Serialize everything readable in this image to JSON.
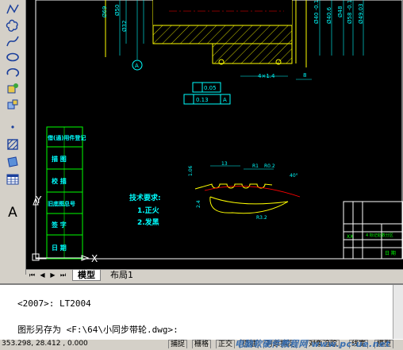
{
  "toolbar": {
    "tools": [
      {
        "icon": "polyline-icon"
      },
      {
        "icon": "revcloud-icon"
      },
      {
        "icon": "spline-icon"
      },
      {
        "icon": "ellipse-icon"
      },
      {
        "icon": "ellipse-arc-icon"
      },
      {
        "icon": "insert-block-icon"
      },
      {
        "icon": "make-block-icon"
      },
      {
        "icon": "point-icon"
      },
      {
        "icon": "hatch-icon"
      },
      {
        "icon": "region-icon"
      },
      {
        "icon": "table-icon"
      },
      {
        "icon": "mtext-icon",
        "glyph": "A"
      }
    ]
  },
  "drawing": {
    "dims": {
      "d1": "4×1.4",
      "d2": "8",
      "gdt1": "0.05",
      "gdt2": "0.13",
      "gdt_datum": "A",
      "datum_a": "A",
      "v1": "Ø69",
      "v2": "Ø50",
      "v3": "Ø32",
      "v4": "Ø40.6",
      "v5": "Ø40 -0.1",
      "v6": "Ø48",
      "v7": "Ø58 -0.1",
      "v8": "Ø49.03",
      "p1": "R0.2",
      "p2": "13",
      "p3": "R1",
      "p4": "40°",
      "p5": "R3.2",
      "p6": "1.06",
      "p7": "2.4"
    },
    "notes": {
      "title": "技术要求:",
      "item1": "1.正火",
      "item2": "2.发黑"
    },
    "side_labels": [
      "借(通)用件登记",
      "描 图",
      "校 描",
      "旧底图总号",
      "签 字",
      "日 期"
    ],
    "title_block_left": "XX",
    "title_block_mid": "4 标记处数分区",
    "title_block_bottom": "日 期"
  },
  "ucs": {
    "x": "X",
    "y": "Y"
  },
  "tabs": {
    "model": "模型",
    "layout1": "布局1"
  },
  "command": {
    "line1": "<2007>: LT2004",
    "line2": "图形另存为 <F:\\64\\小同步带轮.dwg>:"
  },
  "status": {
    "coords": "353.298, 28.412 , 0.000",
    "buttons": [
      "捕捉",
      "栅格",
      "正交",
      "极轴",
      "对象捕捉",
      "对象追踪",
      "线宽",
      "模型"
    ]
  },
  "watermark": "电脑软硬件教程网 www.pc-ue.net",
  "colors": {
    "canvas": "#000000",
    "geometry": "#ffff00",
    "dimension": "#00ffff",
    "border": "#ffffff",
    "pitch_circle": "#ff0000",
    "frame_green": "#00ff00"
  }
}
